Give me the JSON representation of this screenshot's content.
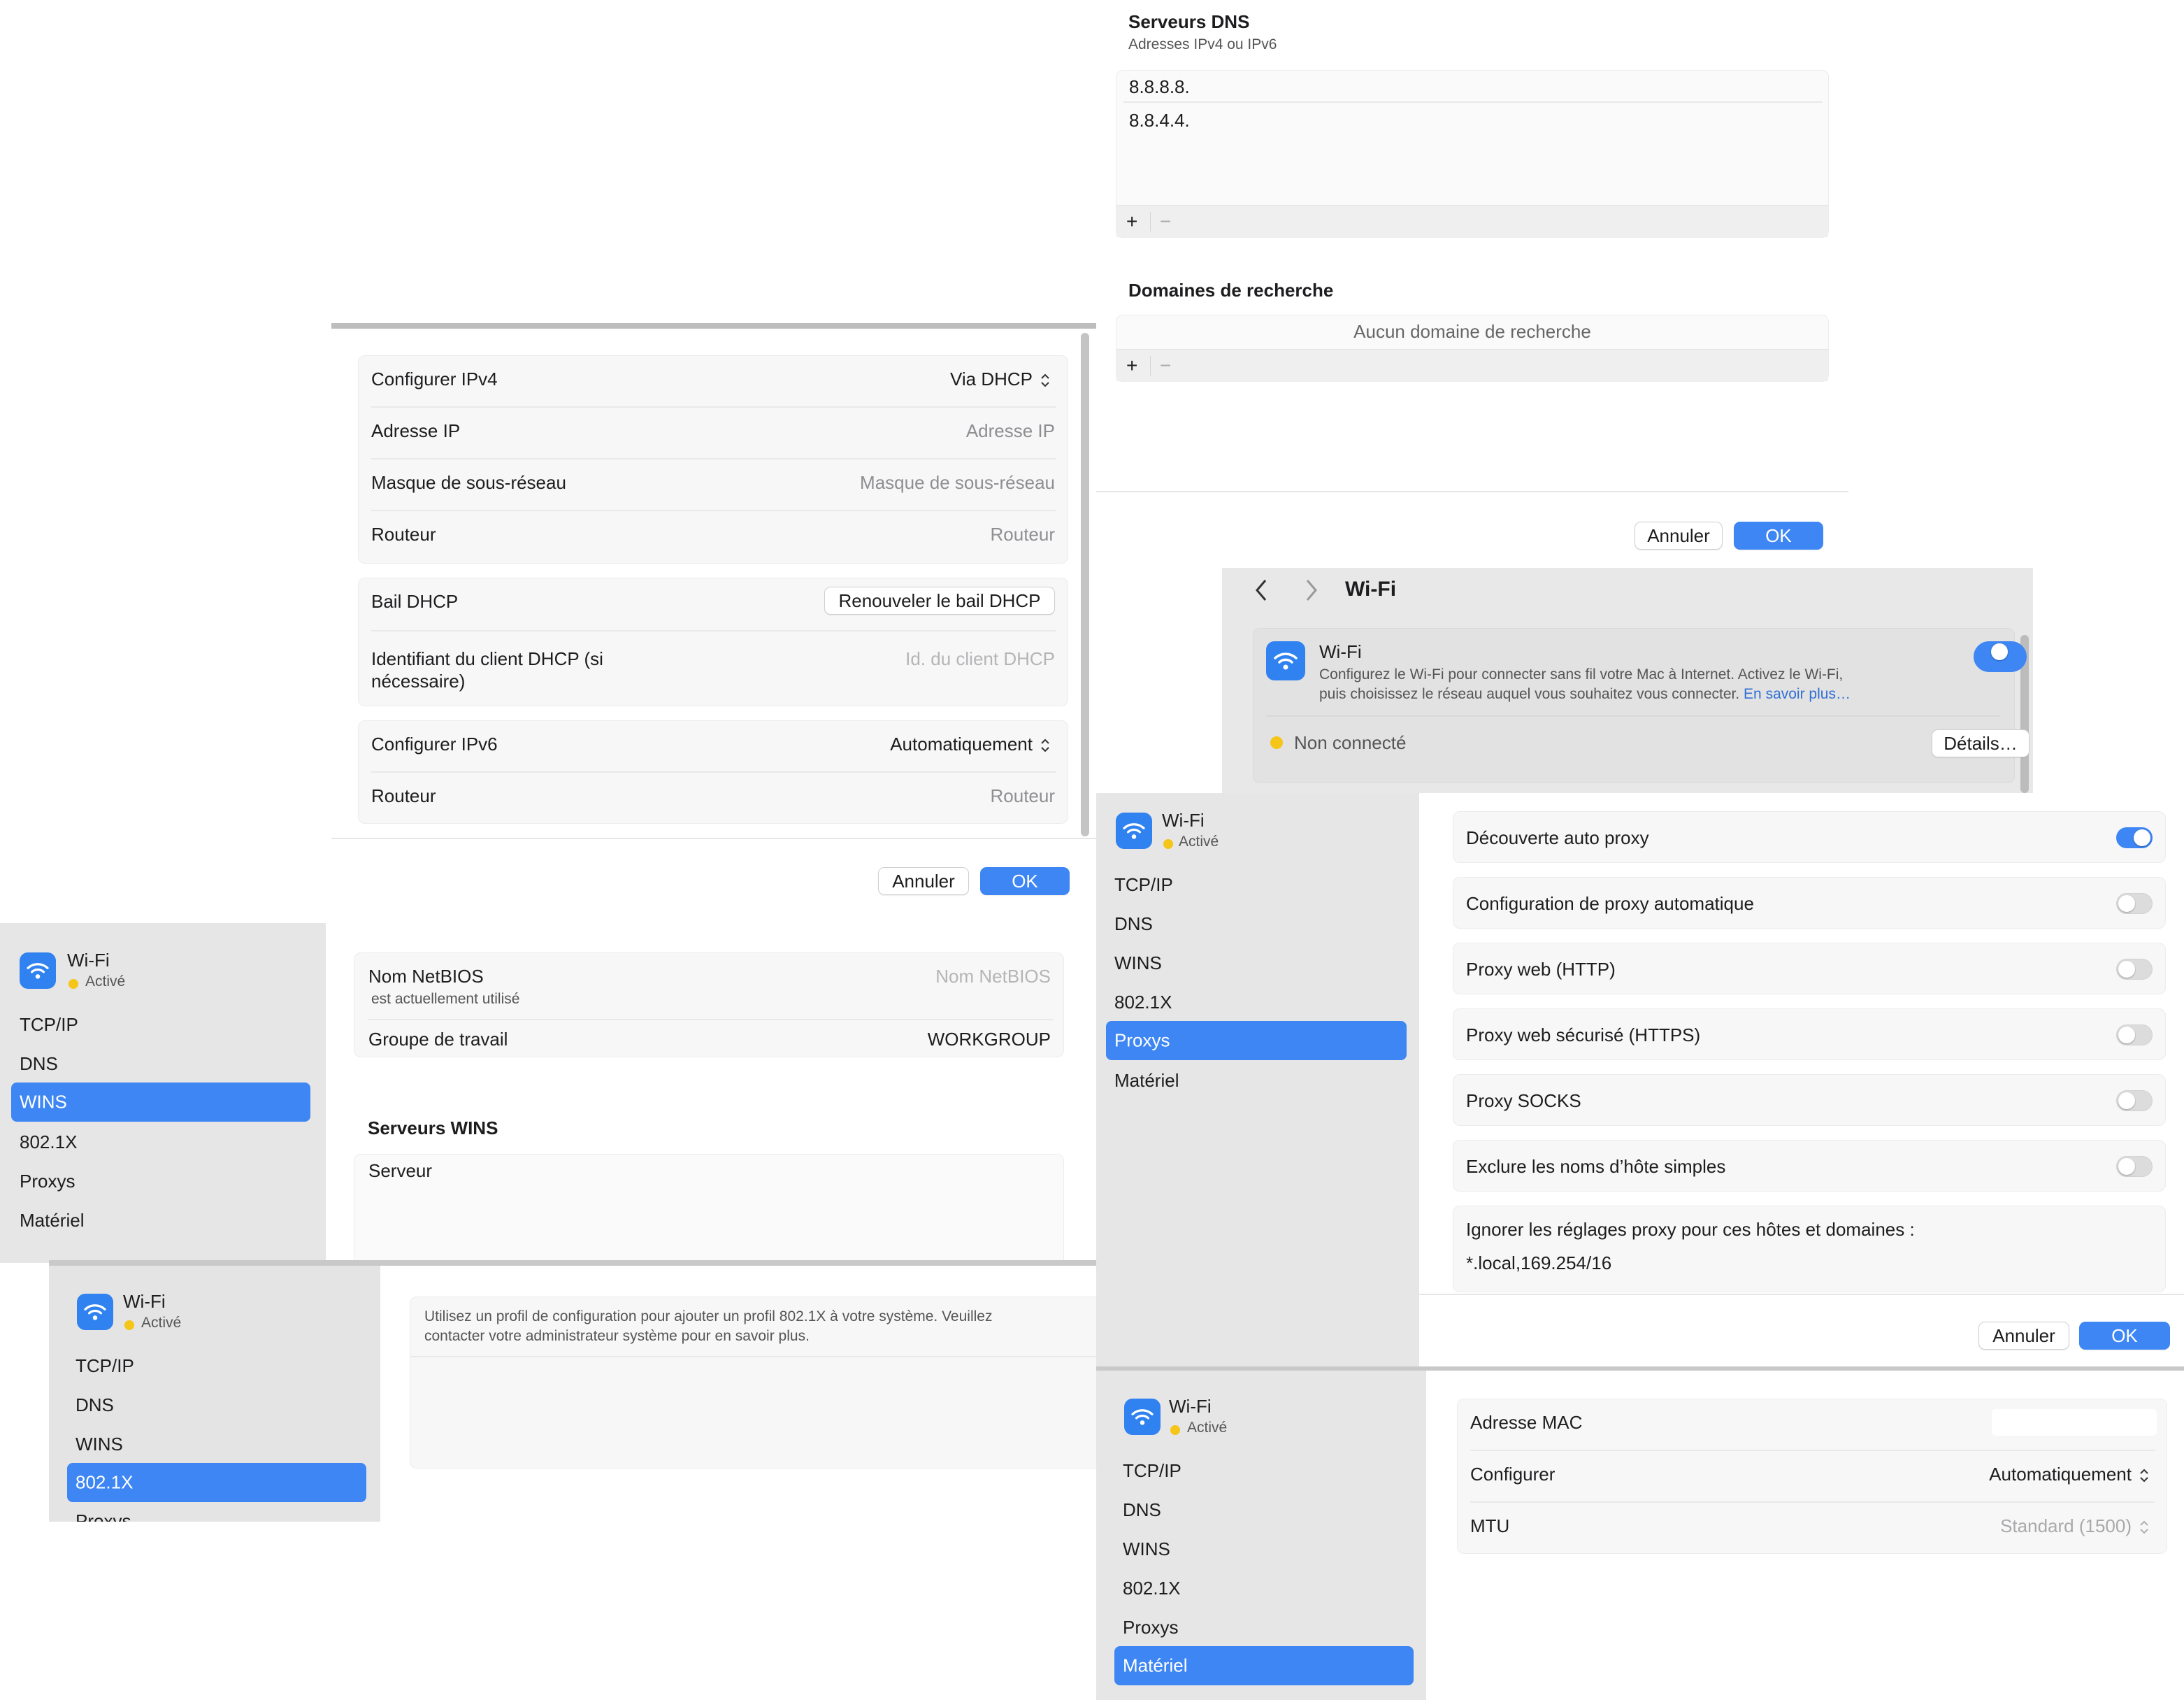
{
  "dns": {
    "title": "Serveurs DNS",
    "subtitle": "Adresses IPv4 ou IPv6",
    "servers": [
      "8.8.8.8.",
      "8.8.4.4."
    ],
    "add": "+",
    "remove": "−",
    "search_title": "Domaines de recherche",
    "search_empty": "Aucun domaine de recherche",
    "cancel": "Annuler",
    "ok": "OK"
  },
  "tcpip": {
    "rows": {
      "ipv4_label": "Configurer IPv4",
      "ipv4_value": "Via DHCP",
      "ip_label": "Adresse IP",
      "ip_placeholder": "Adresse IP",
      "mask_label": "Masque de sous-réseau",
      "mask_placeholder": "Masque de sous-réseau",
      "router_label": "Routeur",
      "router_placeholder": "Routeur",
      "dhcp_label": "Bail DHCP",
      "dhcp_button": "Renouveler le bail DHCP",
      "client_label_1": "Identifiant du client DHCP (si",
      "client_label_2": "nécessaire)",
      "client_placeholder": "Id. du client DHCP",
      "ipv6_label": "Configurer IPv6",
      "ipv6_value": "Automatiquement",
      "router6_label": "Routeur",
      "router6_placeholder": "Routeur"
    },
    "cancel": "Annuler",
    "ok": "OK"
  },
  "wifi_panel": {
    "title": "Wi-Fi",
    "card_title": "Wi-Fi",
    "desc_1": "Configurez le Wi-Fi pour connecter sans fil votre Mac à Internet. Activez le Wi-Fi,",
    "desc_2": "puis choisissez le réseau auquel vous souhaitez vous connecter.",
    "learn_more": "En savoir plus…",
    "status": "Non connecté",
    "details": "Détails…",
    "toggle_on": true,
    "status_color": "#f5c518"
  },
  "sidebar": {
    "network": "Wi-Fi",
    "state": "Activé",
    "items": [
      "TCP/IP",
      "DNS",
      "WINS",
      "802.1X",
      "Proxys",
      "Matériel"
    ],
    "cut_item": "Proxys"
  },
  "proxies": {
    "rows": [
      {
        "label": "Découverte auto proxy",
        "on": true
      },
      {
        "label": "Configuration de proxy automatique",
        "on": false
      },
      {
        "label": "Proxy web (HTTP)",
        "on": false
      },
      {
        "label": "Proxy web sécurisé (HTTPS)",
        "on": false
      },
      {
        "label": "Proxy SOCKS",
        "on": false
      },
      {
        "label": "Exclure les noms d’hôte simples",
        "on": false
      }
    ],
    "bypass_label": "Ignorer les réglages proxy pour ces hôtes et domaines :",
    "bypass_value": "*.local,169.254/16",
    "cancel": "Annuler",
    "ok": "OK"
  },
  "wins": {
    "netbios_label": "Nom NetBIOS",
    "netbios_note": "est actuellement utilisé",
    "netbios_placeholder": "Nom NetBIOS",
    "workgroup_label": "Groupe de travail",
    "workgroup_value": "WORKGROUP",
    "servers_title": "Serveurs WINS",
    "server_col": "Serveur"
  },
  "dot1x": {
    "info_1": "Utilisez un profil de configuration pour ajouter un profil 802.1X à votre système. Veuillez",
    "info_2": "contacter votre administrateur système pour en savoir plus."
  },
  "hardware": {
    "mac_label": "Adresse MAC",
    "config_label": "Configurer",
    "config_value": "Automatiquement",
    "mtu_label": "MTU",
    "mtu_value": "Standard (1500)"
  },
  "colors": {
    "accent": "#3d86f4",
    "sidebar": "#e6e6e6",
    "group": "#f7f7f7"
  }
}
